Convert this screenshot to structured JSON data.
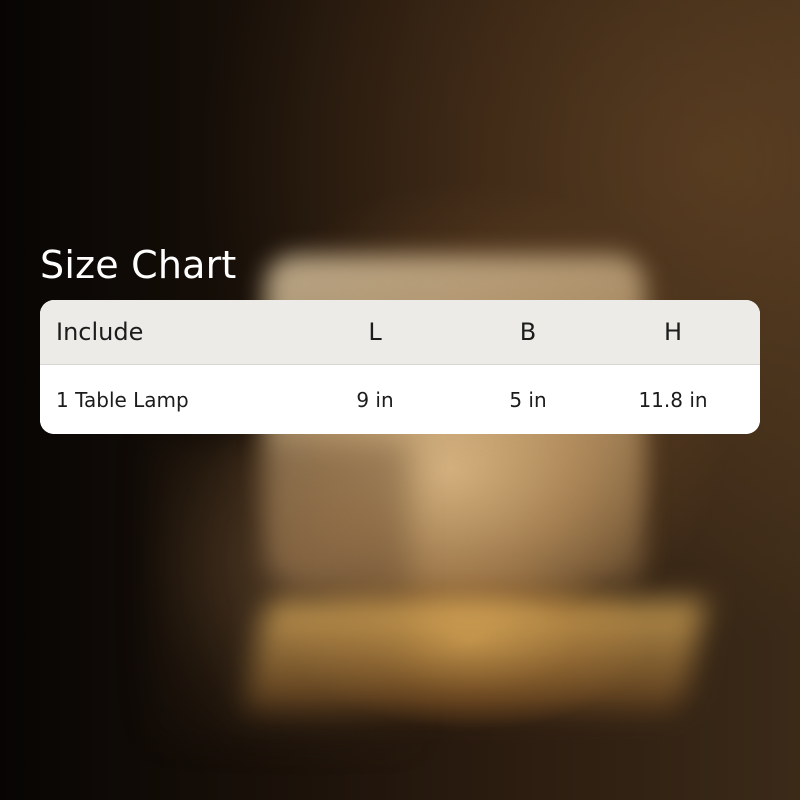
{
  "title": "Size Chart",
  "table": {
    "headers": [
      "Include",
      "L",
      "B",
      "H"
    ],
    "rows": [
      [
        "1 Table Lamp",
        "9 in",
        "5 in",
        "11.8 in"
      ]
    ]
  }
}
